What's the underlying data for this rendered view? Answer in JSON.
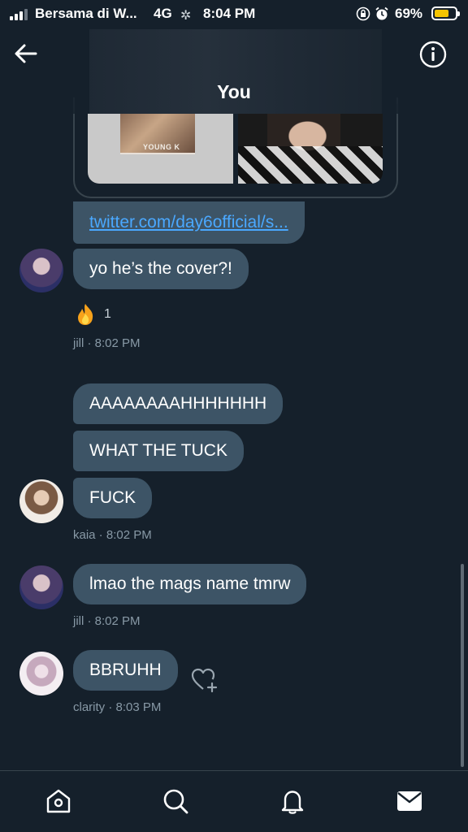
{
  "status_bar": {
    "carrier": "Bersama di W...",
    "network": "4G",
    "time": "8:04 PM",
    "battery_percent": "69%",
    "battery_level": 0.69,
    "battery_color": "#f5c400"
  },
  "header": {
    "title": "You",
    "back_icon": "arrow-left-icon",
    "info_icon": "info-circle-icon"
  },
  "shared_card": {
    "cover_label": "YOUNG K",
    "link_text": "twitter.com/day6official/s..."
  },
  "messages": [
    {
      "sender": "jill",
      "text": "yo he’s the cover?!",
      "reaction_emoji": "fire",
      "reaction_count": "1",
      "meta": "jill · 8:02 PM"
    },
    {
      "sender": "kaia",
      "texts": [
        "AAAAAAAAHHHHHHH",
        "WHAT THE TUCK",
        "FUCK"
      ],
      "meta": "kaia · 8:02 PM"
    },
    {
      "sender": "jill",
      "text": "lmao the mags name tmrw",
      "meta": "jill · 8:02 PM"
    },
    {
      "sender": "clarity",
      "text": "BBRUHH",
      "meta": "clarity · 8:03 PM"
    }
  ],
  "bottom_nav": [
    "home-icon",
    "search-icon",
    "bell-icon",
    "envelope-icon"
  ],
  "colors": {
    "background": "#15202b",
    "bubble": "#3d5466",
    "link": "#4aa8ff",
    "meta_text": "#8899a6"
  }
}
